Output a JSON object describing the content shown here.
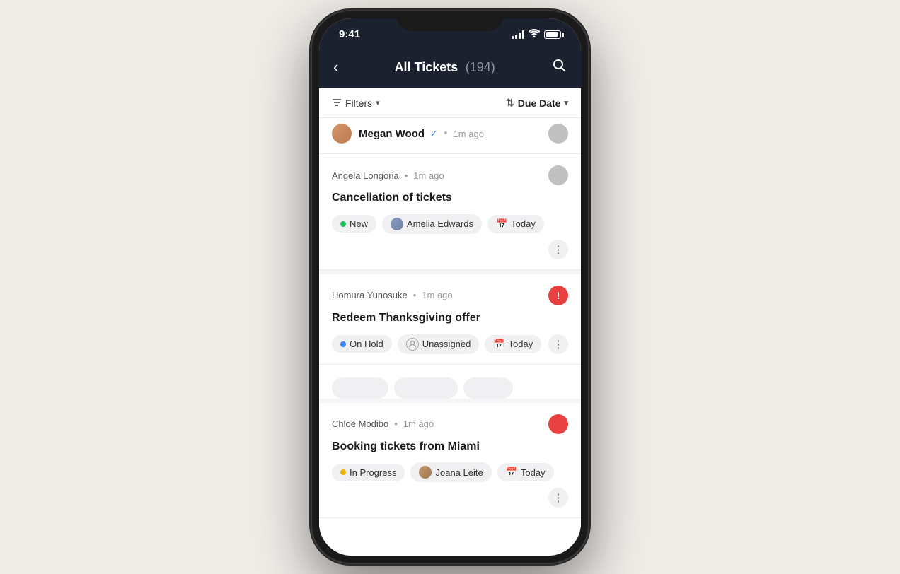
{
  "phone": {
    "time": "9:41",
    "notch": true
  },
  "nav": {
    "title": "All Tickets",
    "count": "(194)",
    "back_label": "‹",
    "search_label": "⌕"
  },
  "filters": {
    "filter_label": "Filters",
    "sort_label": "Due Date",
    "sort_icon": "↕"
  },
  "tickets": [
    {
      "id": "ticket-top-partial",
      "author": "Megan Wood",
      "verified": true,
      "time": "1m ago",
      "status_type": "gray"
    },
    {
      "id": "ticket-1",
      "author": "Angela Longoria",
      "time": "1m ago",
      "title": "Cancellation of tickets",
      "status_type": "gray",
      "tags": [
        {
          "type": "status",
          "dot_color": "green",
          "label": "New"
        },
        {
          "type": "user",
          "label": "Amelia Edwards"
        },
        {
          "type": "date",
          "label": "Today"
        }
      ],
      "more": true
    },
    {
      "id": "ticket-2",
      "author": "Homura Yunosuke",
      "time": "1m ago",
      "title": "Redeem Thanksgiving offer",
      "status_type": "alert",
      "tags": [
        {
          "type": "status",
          "dot_color": "blue",
          "label": "On Hold"
        },
        {
          "type": "unassigned",
          "label": "Unassigned"
        },
        {
          "type": "date",
          "label": "Today"
        }
      ],
      "more": true
    },
    {
      "id": "ticket-3",
      "author": "Chloé Modibo",
      "time": "1m ago",
      "title": "Booking tickets from Miami",
      "status_type": "red",
      "tags": [
        {
          "type": "status",
          "dot_color": "yellow",
          "label": "In Progress"
        },
        {
          "type": "user",
          "label": "Joana Leite"
        },
        {
          "type": "date",
          "label": "Today"
        }
      ],
      "more": true
    }
  ],
  "colors": {
    "nav_bg": "#1c2130",
    "accent_blue": "#3b82f6",
    "green": "#22c55e",
    "yellow": "#eab308",
    "red": "#e84040"
  }
}
